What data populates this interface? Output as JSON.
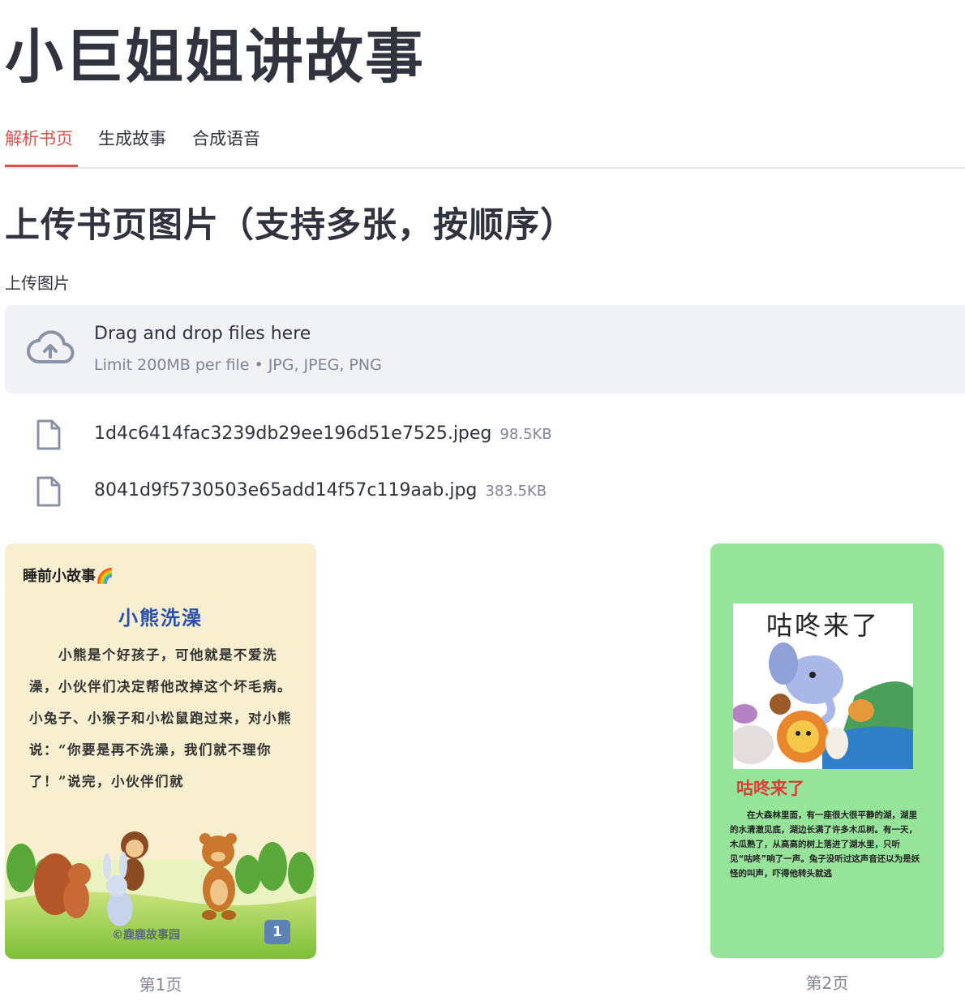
{
  "app": {
    "title": "小巨姐姐讲故事"
  },
  "tabs": [
    {
      "label": "解析书页",
      "active": true
    },
    {
      "label": "生成故事",
      "active": false
    },
    {
      "label": "合成语音",
      "active": false
    }
  ],
  "section": {
    "title": "上传书页图片（支持多张，按顺序）"
  },
  "uploader": {
    "label": "上传图片",
    "drop_title": "Drag and drop files here",
    "drop_subtitle": "Limit 200MB per file • JPG, JPEG, PNG",
    "files": [
      {
        "name": "1d4c6414fac3239db29ee196d51e7525.jpeg",
        "size": "98.5KB"
      },
      {
        "name": "8041d9f5730503e65add14f57c119aab.jpg",
        "size": "383.5KB"
      }
    ]
  },
  "pages": [
    {
      "caption": "第1页",
      "header": "睡前小故事🌈",
      "title": "小熊洗澡",
      "body": "　　小熊是个好孩子，可他就是不爱洗澡，小伙伴们决定帮他改掉这个坏毛病。　　小兔子、小猴子和小松鼠跑过来，对小熊说：“你要是再不洗澡，我们就不理你了！”说完，小伙伴们就",
      "watermark": "©鹿鹿故事园",
      "page_number": "1"
    },
    {
      "caption": "第2页",
      "illustration_title": "咕咚来了",
      "title": "咕咚来了",
      "body": "　　在大森林里面，有一座很大很平静的湖，湖里的水清澈见底，湖边长满了许多木瓜树。有一天，木瓜熟了，从高高的树上落进了湖水里，只听见“咕咚”响了一声。兔子没听过这声音还以为是妖怪的叫声，吓得他转头就逃"
    }
  ],
  "colors": {
    "accent": "#e0504b",
    "text": "#31333f",
    "muted": "#808495",
    "dropzone_bg": "#f0f2f6"
  }
}
